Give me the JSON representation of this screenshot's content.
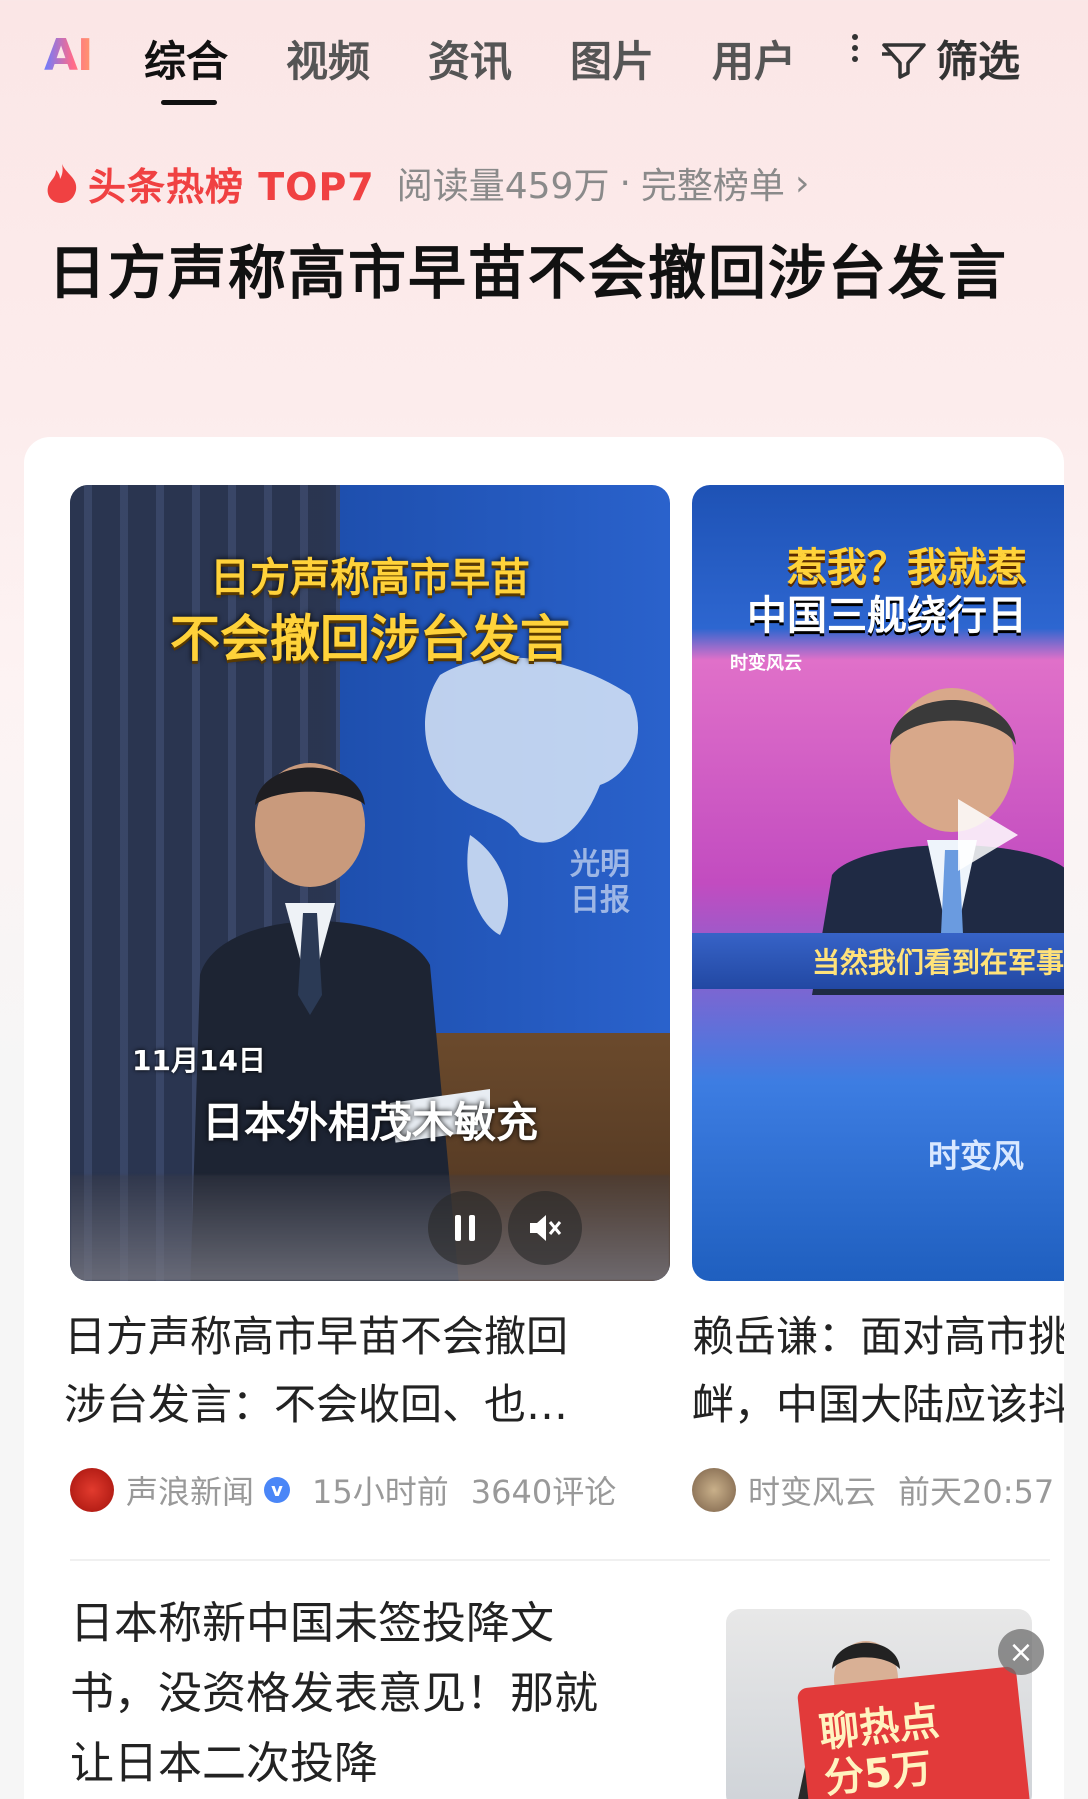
{
  "tabs": {
    "ai_label": "AI",
    "items": [
      "综合",
      "视频",
      "资讯",
      "图片",
      "用户"
    ],
    "active_index": 0,
    "filter_label": "筛选"
  },
  "hot": {
    "label": "头条热榜 TOP7",
    "reads": "阅读量459万",
    "separator": "·",
    "full_list": "完整榜单",
    "headline": "日方声称高市早苗不会撤回涉台发言"
  },
  "feed": {
    "video1": {
      "caption_line1": "日方声称高市早苗",
      "caption_line2": "不会撤回涉台发言",
      "watermark": "光明\n日报",
      "date": "11月14日",
      "name_caption": "日本外相茂木敏充",
      "title": "日方声称高市早苗不会撤回涉台发言：不会收回、也…",
      "source": "声浪新闻",
      "time": "15小时前",
      "comments": "3640评论"
    },
    "video2": {
      "caption_line1": "惹我？我就惹",
      "caption_line2": "中国三舰绕行日",
      "source_tag": "时变风云",
      "subtitle": "当然我们看到在军事",
      "logo_text": "时变风",
      "title": "赖岳谦：面对高市挑衅，中国大陆应该抖",
      "source": "时变风云",
      "time": "前天20:57"
    },
    "news2": {
      "title": "日本称新中国未签投降文书，没资格发表意见！那就让日本二次投降",
      "badge": "聊热点\n分5万"
    }
  },
  "colors": {
    "accent_red": "#f04142",
    "text_primary": "#222222",
    "text_muted": "#999999",
    "verified_blue": "#4a86f7",
    "caption_yellow": "#ffd23a"
  }
}
